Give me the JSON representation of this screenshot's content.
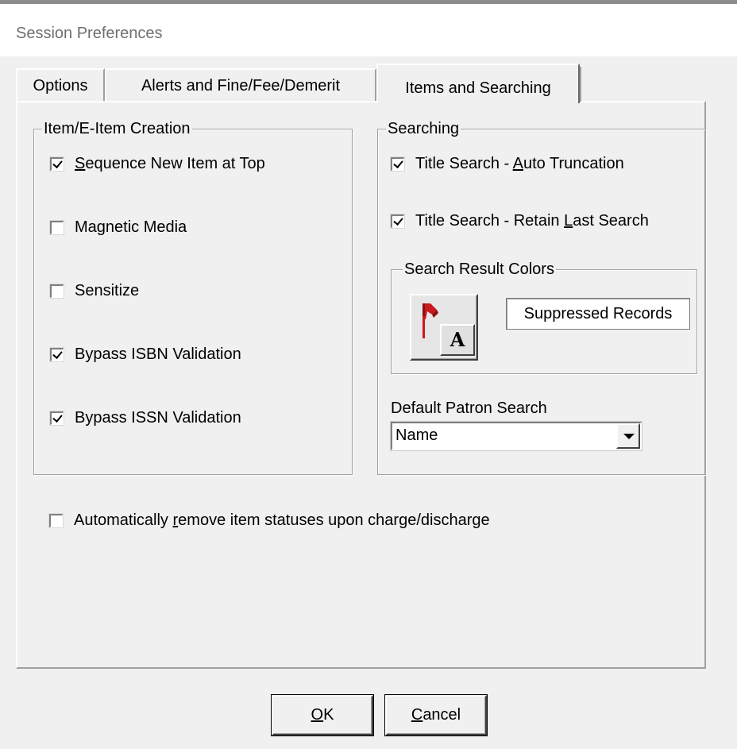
{
  "window": {
    "title": "Session Preferences"
  },
  "tabs": [
    {
      "label": "Options"
    },
    {
      "label": "Alerts and Fine/Fee/Demerit"
    },
    {
      "label": "Items and Searching"
    }
  ],
  "item_creation": {
    "legend": "Item/E-Item Creation",
    "options": [
      {
        "label_ul": "S",
        "label_rest": "equence New Item at Top",
        "checked": true
      },
      {
        "label": "Magnetic Media",
        "checked": false
      },
      {
        "label": "Sensitize",
        "checked": false
      },
      {
        "label": "Bypass ISBN Validation",
        "checked": true
      },
      {
        "label": "Bypass ISSN Validation",
        "checked": true
      }
    ]
  },
  "searching": {
    "legend": "Searching",
    "auto_truncation": {
      "label_pre": "Title Search - ",
      "label_ul": "A",
      "label_post": "uto Truncation",
      "checked": true
    },
    "retain_last": {
      "label_pre": "Title Search - Retain ",
      "label_ul": "L",
      "label_post": "ast Search",
      "checked": true
    },
    "colors": {
      "legend": "Search Result Colors",
      "icon_letter": "A",
      "suppressed_label": "Suppressed Records"
    },
    "default_patron": {
      "label": "Default Patron Search",
      "value": "Name"
    }
  },
  "auto_remove": {
    "label_pre": "Automatically ",
    "label_ul": "r",
    "label_post": "emove item statuses upon charge/discharge",
    "checked": false
  },
  "buttons": {
    "ok_ul": "O",
    "ok_rest": "K",
    "cancel_ul": "C",
    "cancel_rest": "ancel"
  },
  "colors": {
    "pin": "#c8191e",
    "pin_dark": "#8a0f12"
  }
}
